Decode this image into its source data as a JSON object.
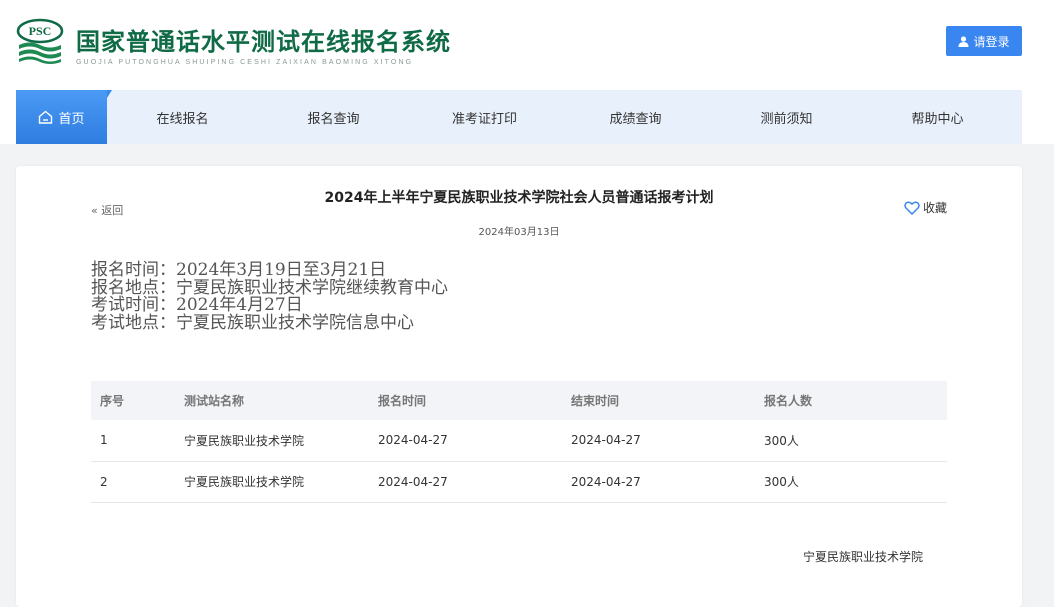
{
  "header": {
    "logo_text": "PSC",
    "site_title": "国家普通话水平测试在线报名系统",
    "site_subtitle": "GUOJIA PUTONGHUA SHUIPING CESHI ZAIXIAN BAOMING XITONG",
    "login_label": "请登录",
    "login_icon": "user-icon"
  },
  "nav": {
    "items": [
      {
        "label": "首页",
        "icon": "home-icon"
      },
      {
        "label": "在线报名"
      },
      {
        "label": "报名查询"
      },
      {
        "label": "准考证打印"
      },
      {
        "label": "成绩查询"
      },
      {
        "label": "测前须知"
      },
      {
        "label": "帮助中心"
      }
    ]
  },
  "article": {
    "back_label": "« 返回",
    "title": "2024年上半年宁夏民族职业技术学院社会人员普通话报考计划",
    "date": "2024年03月13日",
    "favorite_label": "收藏",
    "info_lines": [
      "报名时间：2024年3月19日至3月21日",
      "报名地点：宁夏民族职业技术学院继续教育中心",
      "考试时间：2024年4月27日",
      "考试地点：宁夏民族职业技术学院信息中心"
    ],
    "table": {
      "headers": [
        "序号",
        "测试站名称",
        "报名时间",
        "结束时间",
        "报名人数"
      ],
      "rows": [
        [
          "1",
          "宁夏民族职业技术学院",
          "2024-04-27",
          "2024-04-27",
          "300人"
        ],
        [
          "2",
          "宁夏民族职业技术学院",
          "2024-04-27",
          "2024-04-27",
          "300人"
        ]
      ]
    },
    "signature": "宁夏民族职业技术学院"
  },
  "colors": {
    "brand_green": "#0f6b45",
    "accent_blue": "#3a86f0",
    "nav_bg": "#e8f1fb"
  }
}
